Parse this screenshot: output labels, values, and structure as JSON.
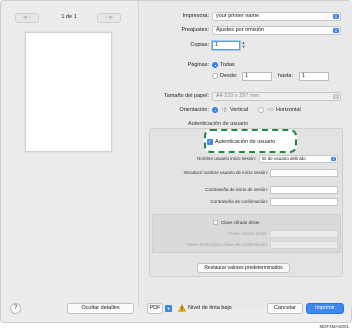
{
  "preview": {
    "page_count": "1 de 1",
    "prev_symbols": "≪ ‹",
    "next_symbols": "› ≫"
  },
  "printer": {
    "label": "Impresora:",
    "value": "your printer name"
  },
  "presets": {
    "label": "Preajustes:",
    "value": "Ajustes por omisión"
  },
  "copies": {
    "label": "Copias:",
    "value": "1"
  },
  "pages": {
    "label": "Páginas:",
    "all_label": "Todas",
    "from_label": "Desde:",
    "from_value": "1",
    "to_label": "hasta:",
    "to_value": "1"
  },
  "paper_size": {
    "label": "Tamaño del papel:",
    "value": "A4  210 x 297 mm"
  },
  "orientation": {
    "label": "Orientación:",
    "portrait": "Vertical",
    "landscape": "Horizontal"
  },
  "section": {
    "title": "Autenticación de usuario"
  },
  "auth": {
    "checkbox_label": "Autenticación de usuario",
    "login_name_label": "Nombre usuario inicio sesión:",
    "login_name_value": "ID de usuario definido",
    "enter_login_label": "Introducir nombre usuario de inicio sesión:",
    "password_label": "Contraseña de inicio de sesión:",
    "confirm_label": "Contraseña de confirmación:",
    "encrypt_label": "Clave cifrado driver",
    "encrypt_key_label": "Clave cifrado driver:",
    "encrypt_confirm_label": "Volver a introducir clave de confirmación:"
  },
  "restore_button": "Restaurar valores predeterminados",
  "bottom": {
    "help": "?",
    "hide_details": "Ocultar detalles",
    "pdf": "PDF",
    "ink_status": "Nivel de tinta bajo",
    "cancel": "Cancelar",
    "print": "Imprimir"
  },
  "doc_code": "MDF4MAS001",
  "colors": {
    "accent": "#3f86ea",
    "highlight_border": "#1f8a44",
    "warning": "#f0b400"
  }
}
